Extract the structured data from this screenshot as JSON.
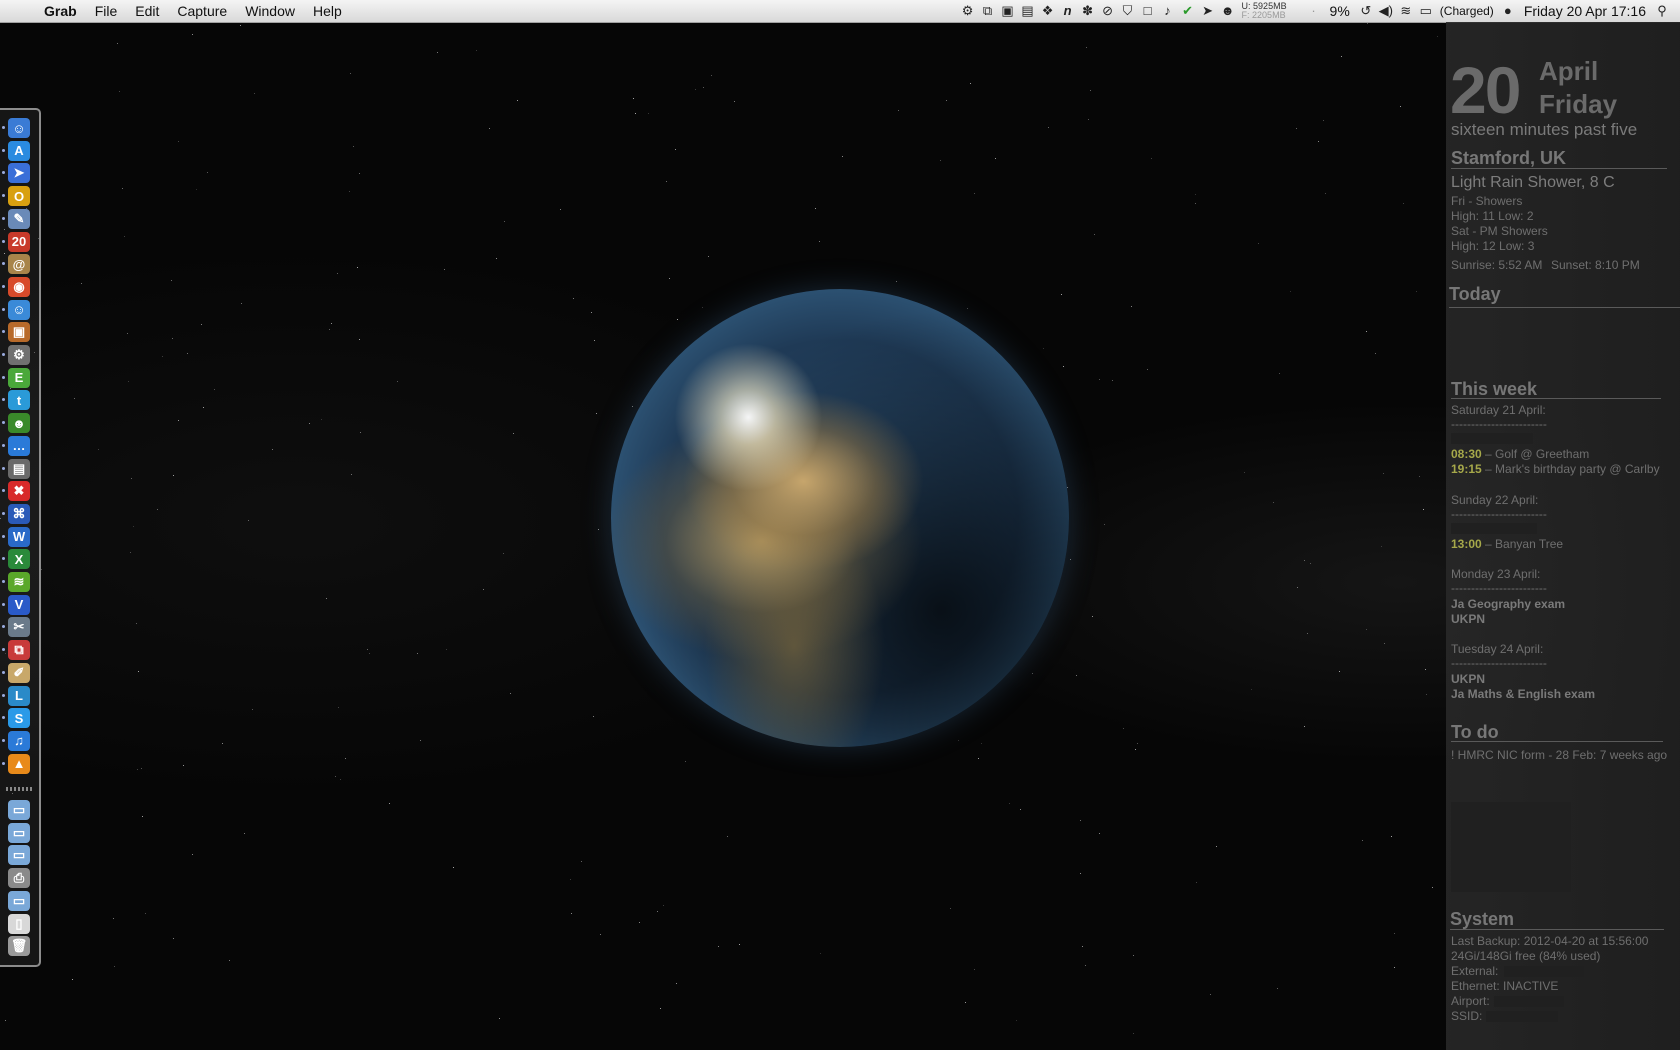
{
  "menubar": {
    "app_name": "Grab",
    "menus": [
      "File",
      "Edit",
      "Capture",
      "Window",
      "Help"
    ],
    "memory_used": "U: 5925MB",
    "memory_free": "F: 2205MB",
    "battery_percent": "9%",
    "battery_status": "(Charged)",
    "clock": "Friday 20 Apr  17:16"
  },
  "sidebar": {
    "date": {
      "day_number": "20",
      "month": "April",
      "weekday": "Friday",
      "time_in_words": "sixteen minutes past five"
    },
    "weather": {
      "location": "Stamford, UK",
      "current": "Light Rain Shower, 8 C",
      "forecast_lines": [
        "Fri - Showers",
        "High: 11 Low: 2",
        "Sat - PM Showers",
        "High: 12 Low: 3"
      ],
      "sunrise": "Sunrise: 5:52 AM",
      "sunset": "Sunset: 8:10 PM"
    },
    "today": {
      "heading": "Today"
    },
    "week": {
      "heading": "This week",
      "divider": "------------------------",
      "days": [
        {
          "label": "Saturday 21 April:",
          "events": [
            {
              "time": "08:30",
              "text": " – Golf @ Greetham"
            },
            {
              "time": "19:15",
              "text": " – Mark's birthday party @ Carlby"
            }
          ]
        },
        {
          "label": "Sunday 22 April:",
          "events": [
            {
              "time": "13:00",
              "text": " – Banyan Tree"
            }
          ]
        },
        {
          "label": "Monday 23 April:",
          "all_day": [
            "Ja Geography exam",
            "UKPN"
          ]
        },
        {
          "label": "Tuesday 24 April:",
          "all_day": [
            "UKPN",
            "Ja Maths & English exam"
          ]
        }
      ]
    },
    "todo": {
      "heading": "To do",
      "items": [
        "! HMRC NIC form - 28 Feb: 7 weeks ago"
      ]
    },
    "system": {
      "heading": "System",
      "lines": [
        "Last Backup: 2012-04-20 at 15:56:00",
        "24Gi/148Gi free (84% used)",
        "External:",
        "Ethernet: INACTIVE",
        "Airport:",
        "SSID:"
      ]
    }
  },
  "dock": {
    "apps": [
      {
        "icon": "finder-icon",
        "glyph": "☺",
        "color": "#3a7bd5"
      },
      {
        "icon": "app-store-icon",
        "glyph": "A",
        "color": "#2a8be0"
      },
      {
        "icon": "send-icon",
        "glyph": "➤",
        "color": "#3a6fd8"
      },
      {
        "icon": "opera-icon",
        "glyph": "O",
        "color": "#d8a010"
      },
      {
        "icon": "preview-icon",
        "glyph": "✎",
        "color": "#6a8ab8"
      },
      {
        "icon": "calendar-icon",
        "glyph": "20",
        "color": "#c83a2a"
      },
      {
        "icon": "address-book-icon",
        "glyph": "@",
        "color": "#a8844a"
      },
      {
        "icon": "chrome-icon",
        "glyph": "◉",
        "color": "#d84a2a"
      },
      {
        "icon": "messenger-icon",
        "glyph": "☺",
        "color": "#3a8ad8"
      },
      {
        "icon": "photos-icon",
        "glyph": "▣",
        "color": "#b86a2a"
      },
      {
        "icon": "utility-icon",
        "glyph": "⚙",
        "color": "#707070"
      },
      {
        "icon": "evernote-icon",
        "glyph": "E",
        "color": "#4aa83a"
      },
      {
        "icon": "twitter-icon",
        "glyph": "t",
        "color": "#2a9ad8"
      },
      {
        "icon": "adium-icon",
        "glyph": "☻",
        "color": "#3a8a2a"
      },
      {
        "icon": "chat-icon",
        "glyph": "…",
        "color": "#2a7ad8"
      },
      {
        "icon": "image-tool-icon",
        "glyph": "▤",
        "color": "#6a6a6a"
      },
      {
        "icon": "xmind-icon",
        "glyph": "✖",
        "color": "#d82a2a"
      },
      {
        "icon": "network-icon",
        "glyph": "⌘",
        "color": "#2a5ab8"
      },
      {
        "icon": "word-icon",
        "glyph": "W",
        "color": "#2a6ac8"
      },
      {
        "icon": "excel-icon",
        "glyph": "X",
        "color": "#2a8a3a"
      },
      {
        "icon": "spotify-icon",
        "glyph": "≋",
        "color": "#5aa82a"
      },
      {
        "icon": "visio-icon",
        "glyph": "V",
        "color": "#2a5ac8"
      },
      {
        "icon": "grab-icon",
        "glyph": "✂",
        "color": "#6a7a8a"
      },
      {
        "icon": "parallels-icon",
        "glyph": "⧉",
        "color": "#c83a3a"
      },
      {
        "icon": "textedit-icon",
        "glyph": "✐",
        "color": "#c8a86a"
      },
      {
        "icon": "lync-icon",
        "glyph": "L",
        "color": "#2a8ac8"
      },
      {
        "icon": "skype-icon",
        "glyph": "S",
        "color": "#2a9ae8"
      },
      {
        "icon": "itunes-icon",
        "glyph": "♫",
        "color": "#2a7ad8"
      },
      {
        "icon": "vlc-icon",
        "glyph": "▲",
        "color": "#e88a1a"
      }
    ],
    "folders": [
      {
        "icon": "folder-icon",
        "glyph": "▭",
        "color": "#7aa8d8"
      },
      {
        "icon": "folder-icon",
        "glyph": "▭",
        "color": "#7aa8d8"
      },
      {
        "icon": "folder-icon",
        "glyph": "▭",
        "color": "#7aa8d8"
      },
      {
        "icon": "printer-icon",
        "glyph": "⎙",
        "color": "#8a8a8a"
      },
      {
        "icon": "folder-icon",
        "glyph": "▭",
        "color": "#7aa8d8"
      },
      {
        "icon": "document-icon",
        "glyph": "▯",
        "color": "#d8d8d8"
      },
      {
        "icon": "trash-icon",
        "glyph": "🗑",
        "color": "#9a9a9a"
      }
    ]
  },
  "colors": {
    "event_time": "#a6a84a",
    "sidebar_text": "#8a8a8a"
  }
}
